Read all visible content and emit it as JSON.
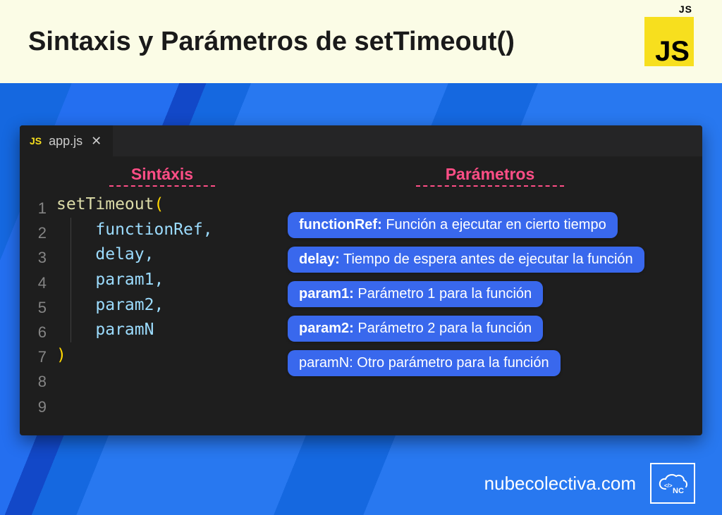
{
  "header": {
    "title": "Sintaxis y Parámetros de setTimeout()",
    "logo_text": "JS"
  },
  "editor": {
    "tab": {
      "lang_badge": "JS",
      "filename": "app.js",
      "close_glyph": "✕"
    },
    "syntax_label": "Sintáxis",
    "params_label": "Parámetros",
    "line_numbers": [
      "1",
      "2",
      "3",
      "4",
      "5",
      "6",
      "7",
      "8",
      "9"
    ],
    "code": {
      "fn": "setTimeout",
      "open": "(",
      "args": [
        "functionRef,",
        "delay,",
        "param1,",
        "param2,",
        "paramN"
      ],
      "close": ")"
    },
    "params": [
      {
        "name": "functionRef:",
        "desc": " Función a ejecutar en cierto tiempo",
        "bold": true
      },
      {
        "name": "delay:",
        "desc": " Tiempo de espera antes de ejecutar la función",
        "bold": true
      },
      {
        "name": "param1:",
        "desc": " Parámetro 1 para la función",
        "bold": true
      },
      {
        "name": "param2:",
        "desc": " Parámetro 2 para la función",
        "bold": true
      },
      {
        "name": "paramN:",
        "desc": " Otro parámetro para la función",
        "bold": false
      }
    ]
  },
  "footer": {
    "url": "nubecolectiva.com",
    "brand_label": "NC"
  }
}
